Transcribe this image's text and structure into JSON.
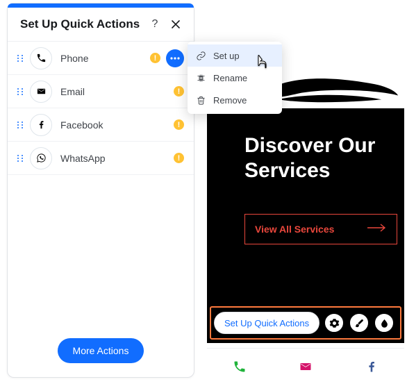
{
  "panel": {
    "title": "Set Up Quick Actions",
    "help_label": "?",
    "actions": [
      {
        "id": "phone",
        "label": "Phone",
        "icon": "phone-icon",
        "warning": true,
        "overflow_open": true
      },
      {
        "id": "email",
        "label": "Email",
        "icon": "email-icon",
        "warning": true,
        "overflow_open": false
      },
      {
        "id": "facebook",
        "label": "Facebook",
        "icon": "facebook-icon",
        "warning": true,
        "overflow_open": false
      },
      {
        "id": "whatsapp",
        "label": "WhatsApp",
        "icon": "whatsapp-icon",
        "warning": true,
        "overflow_open": false
      }
    ],
    "warning_glyph": "!",
    "more_actions": "More Actions"
  },
  "context_menu": {
    "items": [
      {
        "id": "setup",
        "label": "Set up",
        "icon": "link-icon",
        "hover": true
      },
      {
        "id": "rename",
        "label": "Rename",
        "icon": "rename-icon",
        "hover": false
      },
      {
        "id": "remove",
        "label": "Remove",
        "icon": "trash-icon",
        "hover": false
      }
    ]
  },
  "preview": {
    "hero_title_line1": "Discover Our",
    "hero_title_line2": "Services",
    "cta_label": "View All Services",
    "selection_label": "Set Up Quick Actions",
    "tool_gear": "gear-icon",
    "tool_brush": "brush-icon",
    "tool_drop": "drop-icon",
    "bottom": [
      "phone-icon",
      "email-icon",
      "facebook-icon"
    ],
    "colors": {
      "phone": "#20b33b",
      "email": "#d4136a",
      "facebook": "#3b5998",
      "cta": "#e9473c"
    }
  }
}
